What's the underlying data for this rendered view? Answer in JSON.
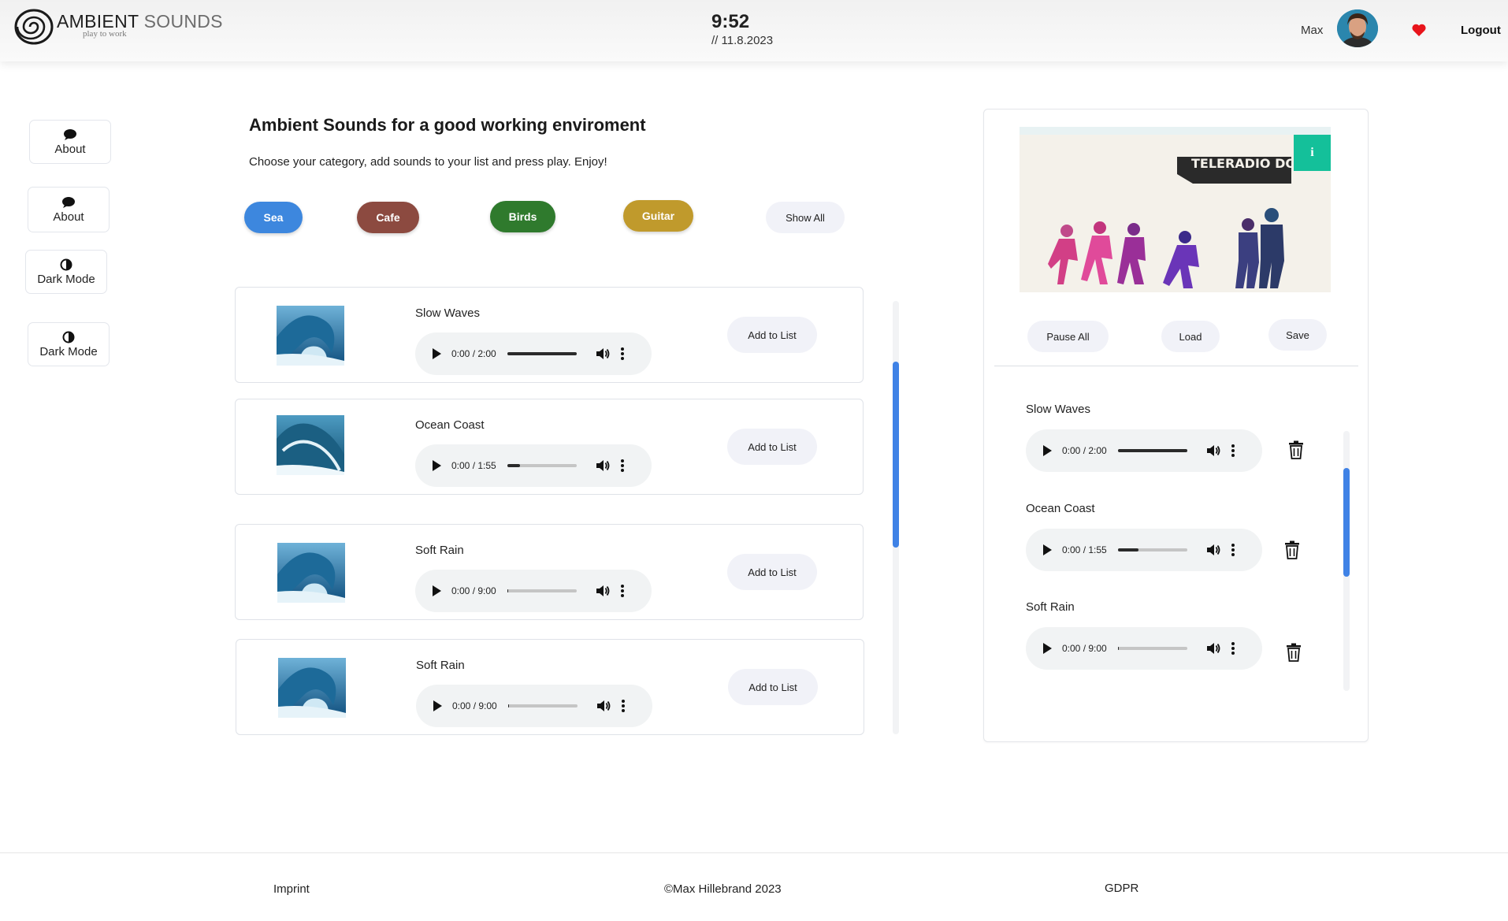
{
  "header": {
    "logo_main": "AMBIENT",
    "logo_light": " SOUNDS",
    "logo_tagline": "play to work",
    "time": "9:52",
    "date": "// 11.8.2023",
    "user_name": "Max",
    "logout_label": "Logout",
    "heart_color": "#e8141b"
  },
  "sidebar": {
    "items": [
      {
        "label": "About",
        "icon": "chat-bubble-icon"
      },
      {
        "label": "About",
        "icon": "chat-bubble-icon"
      },
      {
        "label": "Dark Mode",
        "icon": "contrast-icon"
      },
      {
        "label": "Dark Mode",
        "icon": "contrast-icon"
      }
    ]
  },
  "main": {
    "title": "Ambient Sounds for a good working enviroment",
    "subtitle": "Choose your category, add sounds to your list and press play. Enjoy!",
    "categories": [
      {
        "label": "Sea",
        "color": "#3d87de"
      },
      {
        "label": "Cafe",
        "color": "#8c4a40"
      },
      {
        "label": "Birds",
        "color": "#2f7a2d"
      },
      {
        "label": "Guitar",
        "color": "#c09a2c"
      }
    ],
    "show_all_label": "Show All",
    "sounds": [
      {
        "title": "Slow Waves",
        "time": "0:00 / 2:00",
        "progress": 1.0,
        "add_label": "Add to List"
      },
      {
        "title": "Ocean Coast",
        "time": "0:00 / 1:55",
        "progress": 0.18,
        "add_label": "Add to List"
      },
      {
        "title": "Soft Rain",
        "time": "0:00 / 9:00",
        "progress": 0.02,
        "add_label": "Add to List"
      },
      {
        "title": "Soft Rain",
        "time": "0:00 / 9:00",
        "progress": 0.02,
        "add_label": "Add to List"
      }
    ]
  },
  "panel": {
    "video_caption": "TELERADIO DONOSO",
    "info_label": "i",
    "info_color": "#14c09a",
    "pause_all_label": "Pause All",
    "load_label": "Load",
    "save_label": "Save",
    "playlist": [
      {
        "title": "Slow Waves",
        "time": "0:00 / 2:00",
        "progress": 1.0
      },
      {
        "title": "Ocean Coast",
        "time": "0:00 / 1:55",
        "progress": 0.3
      },
      {
        "title": "Soft Rain",
        "time": "0:00 / 9:00",
        "progress": 0.02
      }
    ]
  },
  "footer": {
    "imprint": "Imprint",
    "copyright": "©Max Hillebrand 2023",
    "gdpr": "GDPR"
  },
  "accent_color": "#3f82e6"
}
